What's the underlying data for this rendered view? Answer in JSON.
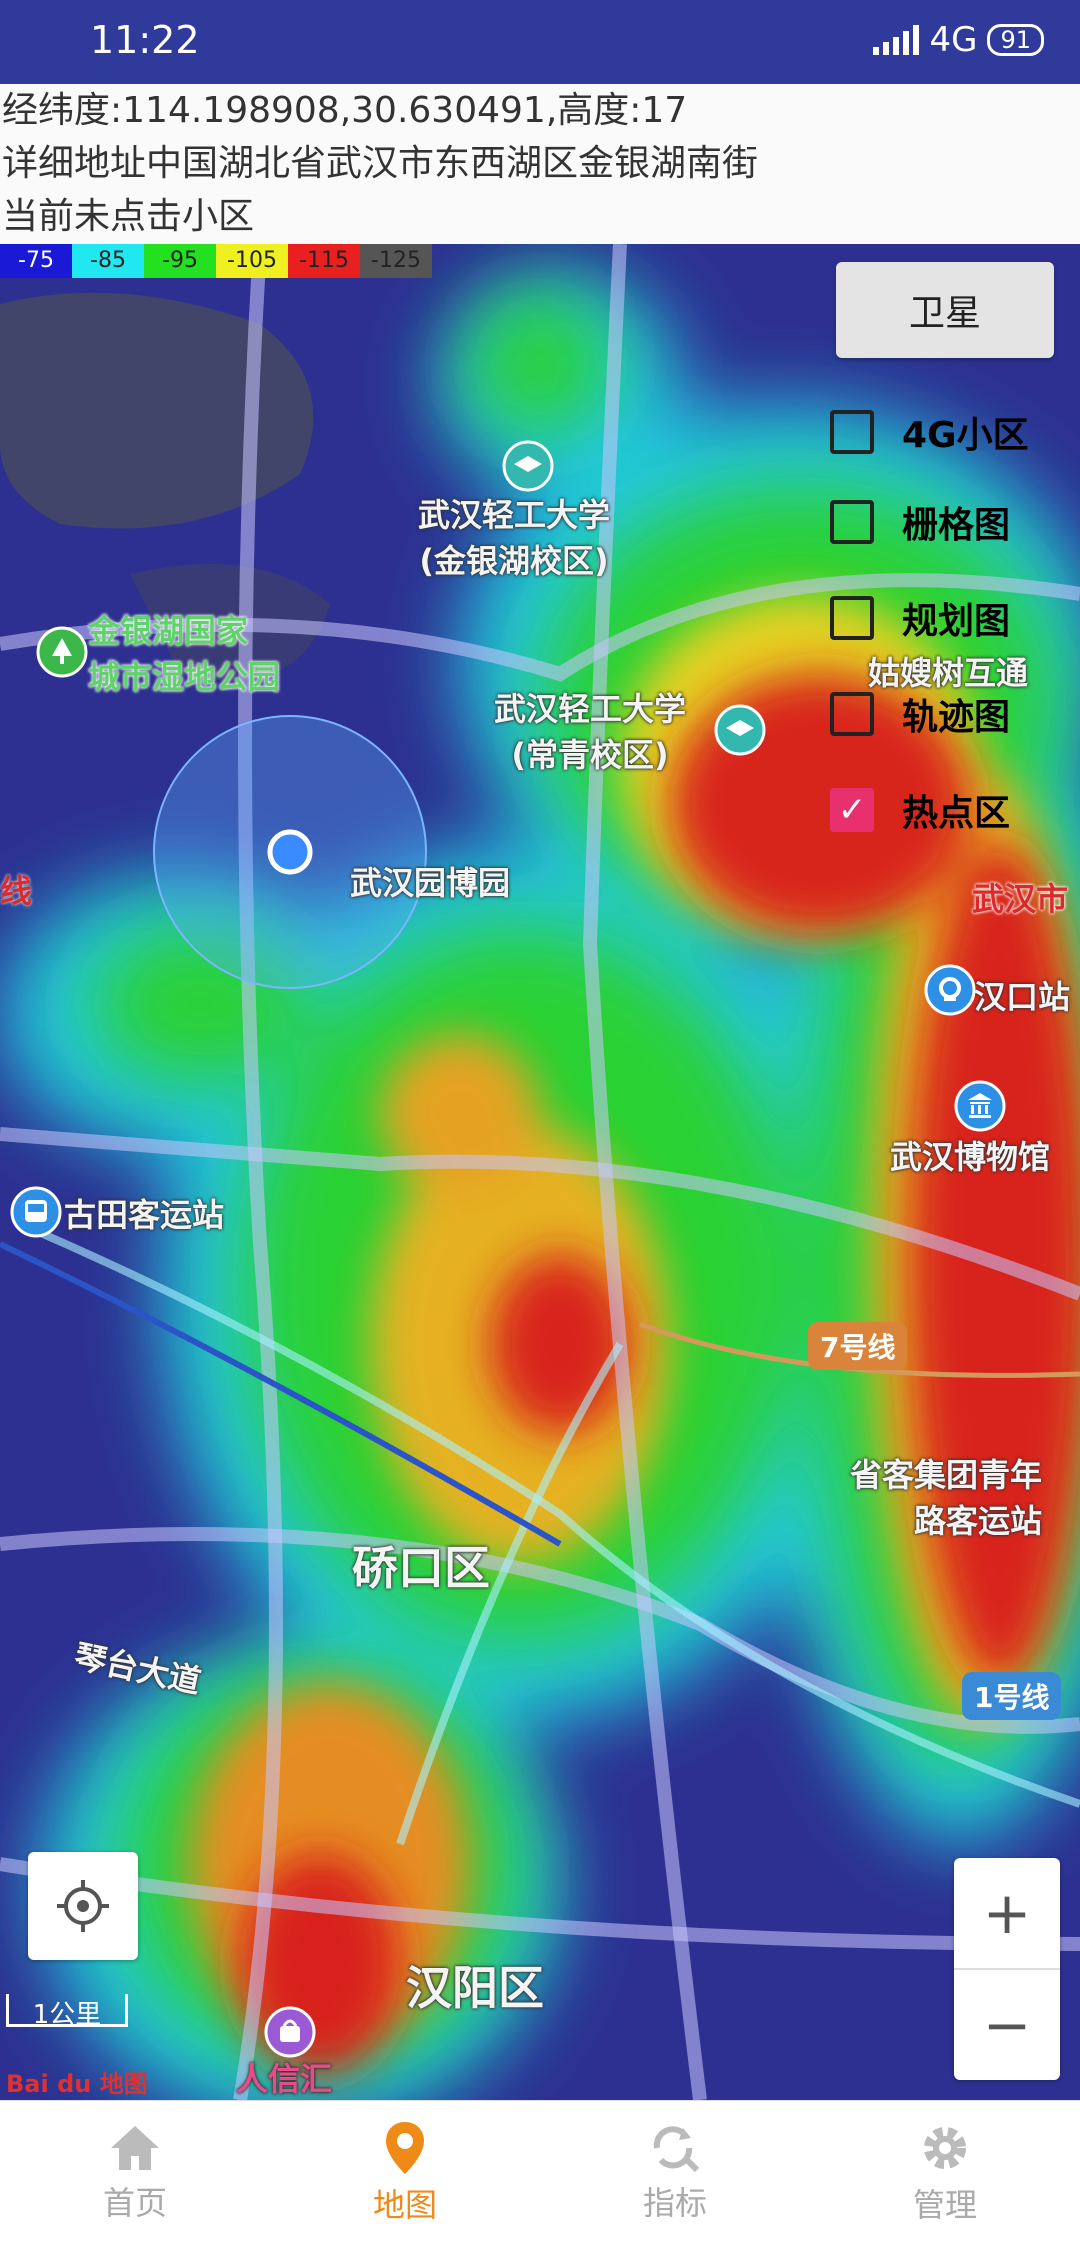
{
  "status": {
    "time": "11:22",
    "network": "4G",
    "battery": "91"
  },
  "info": {
    "coords": "经纬度:114.198908,30.630491,高度:17",
    "address": "详细地址中国湖北省武汉市东西湖区金银湖南街",
    "cell": "当前未点击小区"
  },
  "legend": {
    "labels": [
      "-75",
      "-85",
      "-95",
      "-105",
      "-115",
      "-125"
    ],
    "colors": [
      "#1a1ad6",
      "#21e8f0",
      "#23e020",
      "#f0f020",
      "#e82020",
      "#555555"
    ]
  },
  "controls": {
    "satellite": "卫星",
    "layers": [
      {
        "label": "4G小区",
        "checked": false
      },
      {
        "label": "栅格图",
        "checked": false
      },
      {
        "label": "规划图",
        "checked": false
      },
      {
        "label": "轨迹图",
        "checked": false
      },
      {
        "label": "热点区",
        "checked": true
      }
    ]
  },
  "map_labels": {
    "wqu_jyh": "武汉轻工大学\n(金银湖校区)",
    "wetland": "金银湖国家\n城市湿地公园",
    "wqu_cq": "武汉轻工大学\n(常青校区)",
    "expo": "武汉园博园",
    "gushushu": "姑嫂树互通",
    "wuhan_city": "武汉市",
    "hankou_station": "汉口站",
    "museum": "武汉博物馆",
    "gutian": "古田客运站",
    "line7": "7号线",
    "shengke": "省客集团青年\n路客运站",
    "qiaokou": "硚口区",
    "qintai": "琴台大道",
    "line1": "1号线",
    "hanyang": "汉阳区",
    "renxinhui": "人信汇",
    "line_left": "线"
  },
  "map": {
    "scale": "1公里",
    "logo": "Bai du 地图"
  },
  "nav": [
    {
      "label": "首页",
      "icon": "home-icon",
      "active": false
    },
    {
      "label": "地图",
      "icon": "map-pin-icon",
      "active": true
    },
    {
      "label": "指标",
      "icon": "refresh-search-icon",
      "active": false
    },
    {
      "label": "管理",
      "icon": "gear-icon",
      "active": false
    }
  ]
}
